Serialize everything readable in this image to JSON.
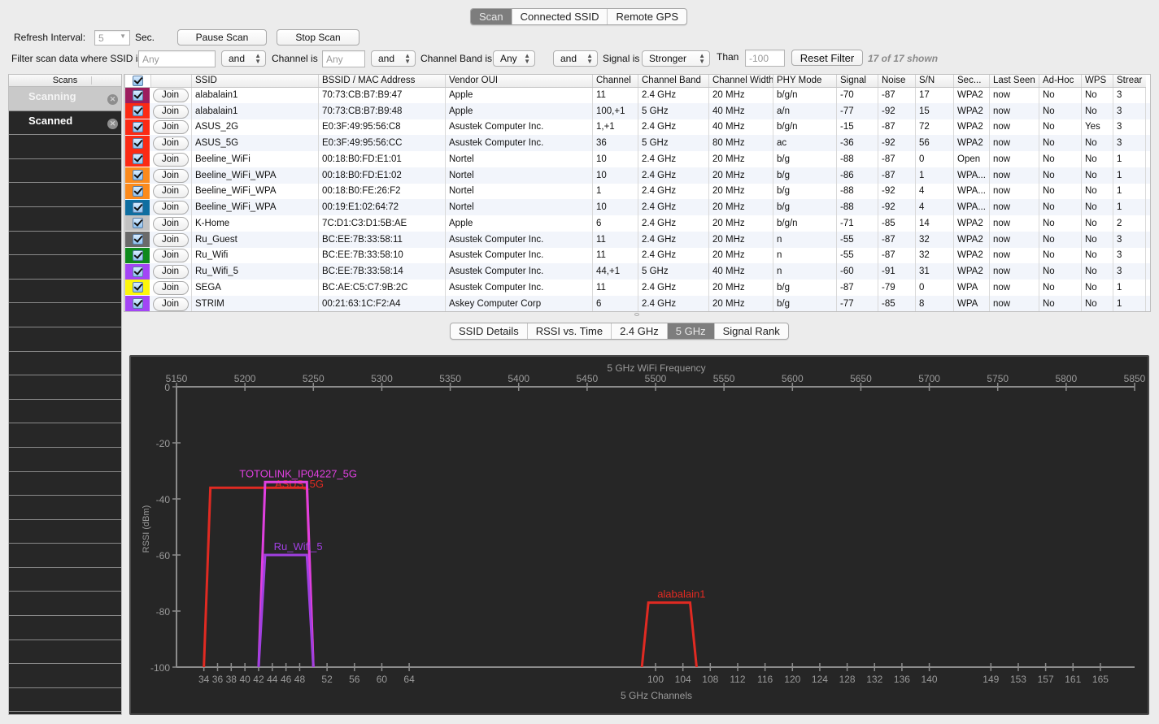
{
  "top_tabs": [
    {
      "label": "Scan",
      "active": true
    },
    {
      "label": "Connected SSID",
      "active": false
    },
    {
      "label": "Remote GPS",
      "active": false
    }
  ],
  "controls": {
    "refresh_label": "Refresh Interval:",
    "refresh_value": "5",
    "refresh_unit": "Sec.",
    "pause_label": "Pause Scan",
    "stop_label": "Stop Scan",
    "filter_ssid_label": "Filter scan data where SSID is",
    "filter_ssid_placeholder": "Any",
    "and1": "and",
    "channel_label": "Channel is",
    "channel_placeholder": "Any",
    "and2": "and",
    "band_label": "Channel Band is",
    "band_value": "Any",
    "and3": "and",
    "signal_label": "Signal is",
    "signal_value": "Stronger",
    "than_label": "Than",
    "than_placeholder": "-100",
    "reset_label": "Reset Filter",
    "shown": "17 of 17 shown"
  },
  "sidebar": {
    "header": "Scans",
    "items": [
      {
        "label": "Scanning",
        "selected": true
      },
      {
        "label": "Scanned",
        "selected": false
      }
    ]
  },
  "table": {
    "columns": [
      "SSID",
      "BSSID / MAC Address",
      "Vendor OUI",
      "Channel",
      "Channel Band",
      "Channel Width",
      "PHY Mode",
      "Signal",
      "Noise",
      "S/N",
      "Sec...",
      "Last Seen",
      "Ad-Hoc",
      "WPS",
      "Strear"
    ],
    "join_label": "Join",
    "rows": [
      {
        "color": "#9c1d5e",
        "cells": [
          "alabalain1",
          "70:73:CB:B7:B9:47",
          "Apple",
          "11",
          "2.4 GHz",
          "20 MHz",
          "b/g/n",
          "-70",
          "-87",
          "17",
          "WPA2",
          "now",
          "No",
          "No",
          "3"
        ]
      },
      {
        "color": "#fb2a14",
        "cells": [
          "alabalain1",
          "70:73:CB:B7:B9:48",
          "Apple",
          "100,+1",
          "5 GHz",
          "40 MHz",
          "a/n",
          "-77",
          "-92",
          "15",
          "WPA2",
          "now",
          "No",
          "No",
          "3"
        ]
      },
      {
        "color": "#fb2a14",
        "cells": [
          "ASUS_2G",
          "E0:3F:49:95:56:C8",
          "Asustek Computer Inc.",
          "1,+1",
          "2.4 GHz",
          "40 MHz",
          "b/g/n",
          "-15",
          "-87",
          "72",
          "WPA2",
          "now",
          "No",
          "Yes",
          "3"
        ]
      },
      {
        "color": "#fb2a14",
        "cells": [
          "ASUS_5G",
          "E0:3F:49:95:56:CC",
          "Asustek Computer Inc.",
          "36",
          "5 GHz",
          "80 MHz",
          "ac",
          "-36",
          "-92",
          "56",
          "WPA2",
          "now",
          "No",
          "No",
          "3"
        ]
      },
      {
        "color": "#fb2a14",
        "cells": [
          "Beeline_WiFi",
          "00:18:B0:FD:E1:01",
          "Nortel",
          "10",
          "2.4 GHz",
          "20 MHz",
          "b/g",
          "-88",
          "-87",
          "0",
          "Open",
          "now",
          "No",
          "No",
          "1"
        ]
      },
      {
        "color": "#fb8a1c",
        "cells": [
          "Beeline_WiFi_WPA",
          "00:18:B0:FD:E1:02",
          "Nortel",
          "10",
          "2.4 GHz",
          "20 MHz",
          "b/g",
          "-86",
          "-87",
          "1",
          "WPA...",
          "now",
          "No",
          "No",
          "1"
        ]
      },
      {
        "color": "#fb8a1c",
        "cells": [
          "Beeline_WiFi_WPA",
          "00:18:B0:FE:26:F2",
          "Nortel",
          "1",
          "2.4 GHz",
          "20 MHz",
          "b/g",
          "-88",
          "-92",
          "4",
          "WPA...",
          "now",
          "No",
          "No",
          "1"
        ]
      },
      {
        "color": "#0f6ea0",
        "cells": [
          "Beeline_WiFi_WPA",
          "00:19:E1:02:64:72",
          "Nortel",
          "10",
          "2.4 GHz",
          "20 MHz",
          "b/g",
          "-88",
          "-92",
          "4",
          "WPA...",
          "now",
          "No",
          "No",
          "1"
        ]
      },
      {
        "color": "#c2c2c2",
        "cells": [
          "K-Home",
          "7C:D1:C3:D1:5B:AE",
          "Apple",
          "6",
          "2.4 GHz",
          "20 MHz",
          "b/g/n",
          "-71",
          "-85",
          "14",
          "WPA2",
          "now",
          "No",
          "No",
          "2"
        ]
      },
      {
        "color": "#6a6a6a",
        "cells": [
          "Ru_Guest",
          "BC:EE:7B:33:58:11",
          "Asustek Computer Inc.",
          "11",
          "2.4 GHz",
          "20 MHz",
          "n",
          "-55",
          "-87",
          "32",
          "WPA2",
          "now",
          "No",
          "No",
          "3"
        ]
      },
      {
        "color": "#0e8a1c",
        "cells": [
          "Ru_Wifi",
          "BC:EE:7B:33:58:10",
          "Asustek Computer Inc.",
          "11",
          "2.4 GHz",
          "20 MHz",
          "n",
          "-55",
          "-87",
          "32",
          "WPA2",
          "now",
          "No",
          "No",
          "3"
        ]
      },
      {
        "color": "#a345f5",
        "cells": [
          "Ru_Wifi_5",
          "BC:EE:7B:33:58:14",
          "Asustek Computer Inc.",
          "44,+1",
          "5 GHz",
          "40 MHz",
          "n",
          "-60",
          "-91",
          "31",
          "WPA2",
          "now",
          "No",
          "No",
          "3"
        ]
      },
      {
        "color": "#fcf60c",
        "cells": [
          "SEGA",
          "BC:AE:C5:C7:9B:2C",
          "Asustek Computer Inc.",
          "11",
          "2.4 GHz",
          "20 MHz",
          "b/g",
          "-87",
          "-79",
          "0",
          "WPA",
          "now",
          "No",
          "No",
          "1"
        ]
      },
      {
        "color": "#a345f5",
        "cells": [
          "STRIM",
          "00:21:63:1C:F2:A4",
          "Askey Computer Corp",
          "6",
          "2.4 GHz",
          "20 MHz",
          "b/g",
          "-77",
          "-85",
          "8",
          "WPA",
          "now",
          "No",
          "No",
          "1"
        ]
      }
    ]
  },
  "view_tabs": [
    {
      "label": "SSID Details",
      "active": false
    },
    {
      "label": "RSSI vs. Time",
      "active": false
    },
    {
      "label": "2.4 GHz",
      "active": false
    },
    {
      "label": "5 GHz",
      "active": true
    },
    {
      "label": "Signal Rank",
      "active": false
    }
  ],
  "chart_data": {
    "type": "line",
    "title": "5 GHz WiFi Frequency",
    "xlabel": "5 GHz Channels",
    "ylabel": "RSSI (dBm)",
    "freq_range": [
      5150,
      5850
    ],
    "freq_ticks": [
      5150,
      5200,
      5250,
      5300,
      5350,
      5400,
      5450,
      5500,
      5550,
      5600,
      5650,
      5700,
      5750,
      5800,
      5850
    ],
    "ylim": [
      -100,
      0
    ],
    "y_ticks": [
      0,
      -20,
      -40,
      -60,
      -80,
      -100
    ],
    "channel_ticks": [
      34,
      36,
      38,
      40,
      42,
      44,
      46,
      48,
      52,
      56,
      60,
      64,
      100,
      104,
      108,
      112,
      116,
      120,
      124,
      128,
      132,
      136,
      140,
      149,
      153,
      157,
      161,
      165
    ],
    "grid": false,
    "background": "#262626",
    "series": [
      {
        "name": "ASUS_5G",
        "color": "#e02a22",
        "start_mhz": 5170,
        "end_mhz": 5250,
        "rssi": -36
      },
      {
        "name": "TOTOLINK_IP04227_5G",
        "color": "#e040e0",
        "start_mhz": 5210,
        "end_mhz": 5250,
        "rssi": -34
      },
      {
        "name": "Ru_Wifi_5",
        "color": "#a040e0",
        "start_mhz": 5210,
        "end_mhz": 5250,
        "rssi": -60
      },
      {
        "name": "alabalain1",
        "color": "#e02a22",
        "start_mhz": 5490,
        "end_mhz": 5530,
        "rssi": -77
      }
    ]
  }
}
